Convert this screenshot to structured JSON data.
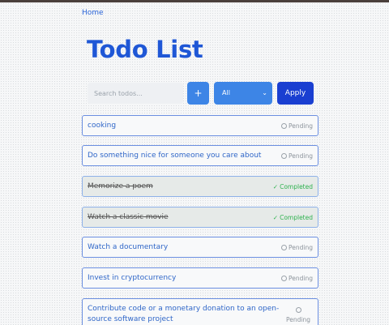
{
  "nav": {
    "home": "Home"
  },
  "page": {
    "title": "Todo List"
  },
  "controls": {
    "search_placeholder": "Search todos...",
    "add_label": "+",
    "filter_value": "All",
    "apply_label": "Apply"
  },
  "todos": [
    {
      "text": "cooking",
      "status": "Pending",
      "completed": false
    },
    {
      "text": "Do something nice for someone you care about",
      "status": "Pending",
      "completed": false
    },
    {
      "text": "Memorize a poem",
      "status": "Completed",
      "completed": true
    },
    {
      "text": "Watch a classic movie",
      "status": "Completed",
      "completed": true
    },
    {
      "text": "Watch a documentary",
      "status": "Pending",
      "completed": false
    },
    {
      "text": "Invest in cryptocurrency",
      "status": "Pending",
      "completed": false
    },
    {
      "text": "Contribute code or a monetary donation to an open-source software project",
      "status": "Pending",
      "completed": false
    }
  ],
  "colors": {
    "accent": "#3d85e6",
    "apply": "#1a3fd1",
    "title": "#1f57d6",
    "completed": "#2fb24f"
  }
}
